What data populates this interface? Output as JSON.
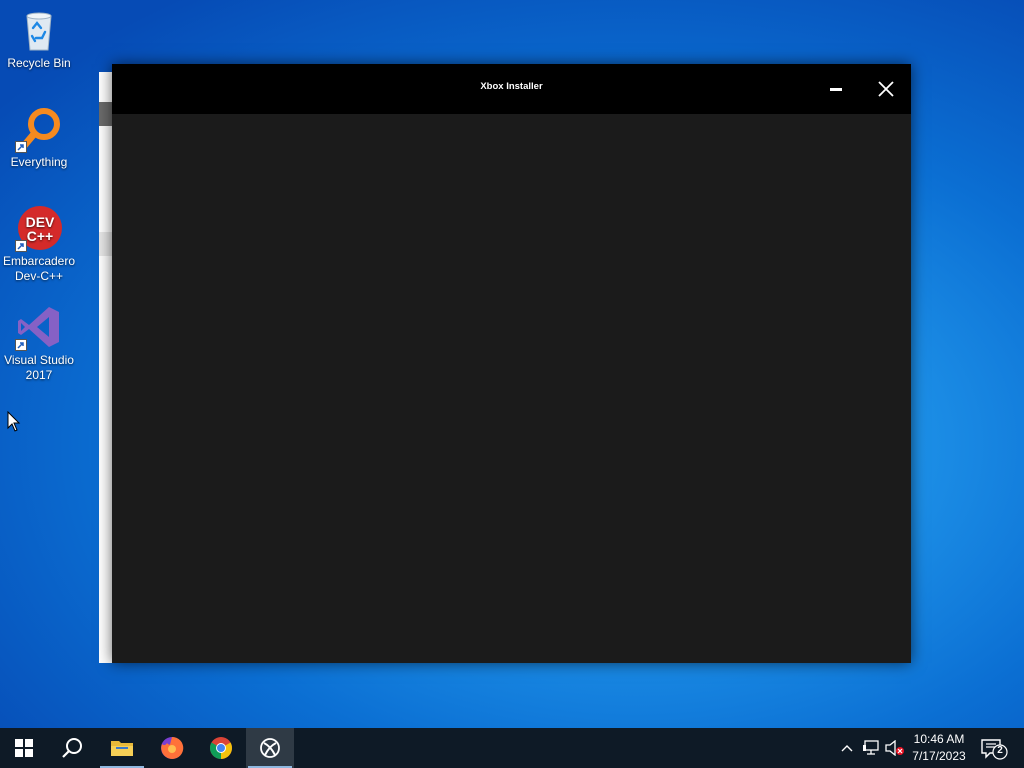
{
  "desktop": {
    "icons": [
      {
        "label": "Recycle Bin",
        "icon": "recycle-bin-icon"
      },
      {
        "label": "Everything",
        "icon": "everything-search-icon"
      },
      {
        "label": "Embarcadero Dev-C++",
        "label_line1": "Embarcadero",
        "label_line2": "Dev-C++",
        "icon": "devcpp-icon",
        "icon_text_1": "DEV",
        "icon_text_2": "C++"
      },
      {
        "label": "Visual Studio 2017",
        "label_line1": "Visual Studio",
        "label_line2": "2017",
        "icon": "visual-studio-icon"
      }
    ]
  },
  "window": {
    "title": "Xbox Installer",
    "controls": [
      "minimize-icon",
      "close-icon"
    ],
    "background_color": "#1b1b1b",
    "titlebar_color": "#000000"
  },
  "taskbar": {
    "buttons": [
      {
        "name": "start",
        "icon": "windows-logo-icon"
      },
      {
        "name": "search",
        "icon": "search-icon"
      },
      {
        "name": "file-explorer",
        "icon": "folder-icon"
      },
      {
        "name": "firefox",
        "icon": "firefox-icon"
      },
      {
        "name": "chrome",
        "icon": "chrome-icon"
      },
      {
        "name": "xbox",
        "icon": "xbox-icon",
        "active": true
      }
    ],
    "tray": {
      "icons": [
        "chevron-up-icon",
        "network-icon",
        "volume-muted-icon"
      ],
      "time": "10:46 AM",
      "date": "7/17/2023",
      "notification_count": "2"
    }
  },
  "colors": {
    "desktop_accent": "#0b6fd3",
    "taskbar": "#0e1a26",
    "active_button": "#2f3a45"
  }
}
